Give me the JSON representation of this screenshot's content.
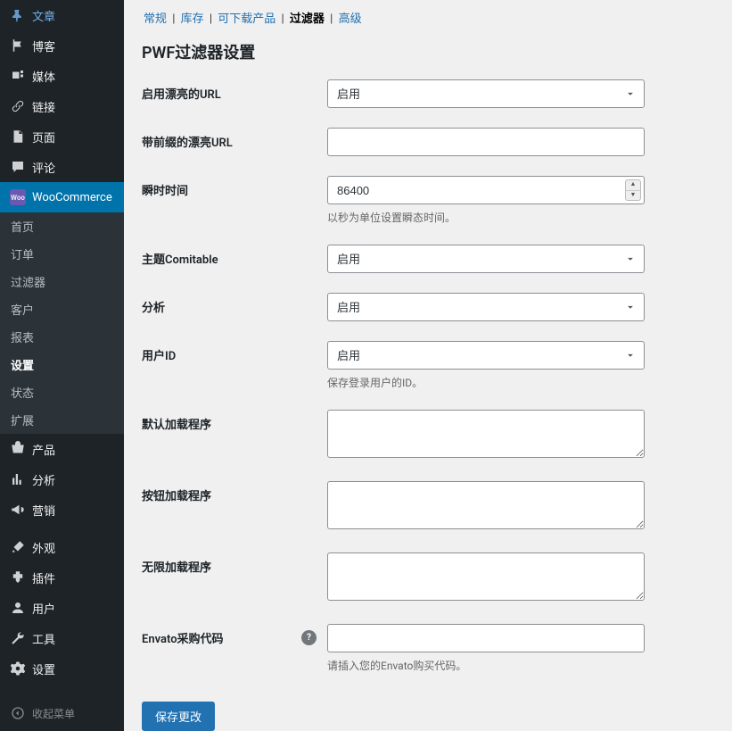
{
  "sidebar": {
    "items": [
      {
        "label": "文章",
        "icon": "pin"
      },
      {
        "label": "博客",
        "icon": "flag"
      },
      {
        "label": "媒体",
        "icon": "media"
      },
      {
        "label": "链接",
        "icon": "link"
      },
      {
        "label": "页面",
        "icon": "page"
      },
      {
        "label": "评论",
        "icon": "comment"
      },
      {
        "label": "WooCommerce",
        "icon": "woo",
        "active": true
      },
      {
        "label": "产品",
        "icon": "product"
      },
      {
        "label": "分析",
        "icon": "chart"
      },
      {
        "label": "营销",
        "icon": "bullhorn"
      },
      {
        "label": "外观",
        "icon": "brush"
      },
      {
        "label": "插件",
        "icon": "plugin"
      },
      {
        "label": "用户",
        "icon": "user"
      },
      {
        "label": "工具",
        "icon": "tool"
      },
      {
        "label": "设置",
        "icon": "settings"
      }
    ],
    "submenu": [
      {
        "label": "首页"
      },
      {
        "label": "订单"
      },
      {
        "label": "过滤器"
      },
      {
        "label": "客户"
      },
      {
        "label": "报表"
      },
      {
        "label": "设置",
        "active": true
      },
      {
        "label": "状态"
      },
      {
        "label": "扩展"
      }
    ],
    "collapse": "收起菜单"
  },
  "tabs": [
    {
      "label": "常规"
    },
    {
      "label": "库存"
    },
    {
      "label": "可下载产品"
    },
    {
      "label": "过滤器",
      "current": true
    },
    {
      "label": "高级"
    }
  ],
  "section_title": "PWF过滤器设置",
  "options": {
    "enable": "启用"
  },
  "fields": {
    "pretty_url": {
      "label": "启用漂亮的URL",
      "value": "启用"
    },
    "prefix_url": {
      "label": "带前缀的漂亮URL",
      "value": ""
    },
    "transient": {
      "label": "瞬时时间",
      "value": "86400",
      "help": "以秒为单位设置瞬态时间。"
    },
    "theme_compat": {
      "label": "主题Comitable",
      "value": "启用"
    },
    "analytics": {
      "label": "分析",
      "value": "启用"
    },
    "user_id": {
      "label": "用户ID",
      "value": "启用",
      "help": "保存登录用户的ID。"
    },
    "default_loader": {
      "label": "默认加载程序",
      "value": ""
    },
    "button_loader": {
      "label": "按钮加载程序",
      "value": ""
    },
    "infinite_loader": {
      "label": "无限加载程序",
      "value": ""
    },
    "envato": {
      "label": "Envato采购代码",
      "value": "",
      "help": "请插入您的Envato购买代码。"
    }
  },
  "save_button": "保存更改"
}
